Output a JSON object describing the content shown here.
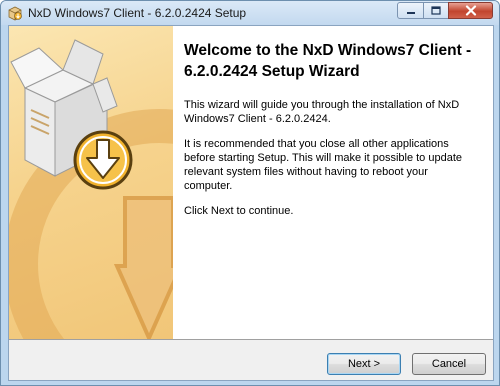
{
  "window": {
    "title": "NxD Windows7 Client - 6.2.0.2424 Setup",
    "icon": "installer-box-icon",
    "controls": [
      "minimize-icon",
      "maximize-icon",
      "close-icon"
    ]
  },
  "wizard": {
    "heading": "Welcome to the NxD Windows7 Client - 6.2.0.2424 Setup Wizard",
    "paragraphs": [
      "This wizard will guide you through the installation of NxD Windows7 Client - 6.2.0.2424.",
      "It is recommended that you close all other applications before starting Setup. This will make it possible to update relevant system files without having to reboot your computer.",
      "Click Next to continue."
    ],
    "side_image": "open-box-download-icon"
  },
  "buttons": {
    "next": "Next >",
    "cancel": "Cancel"
  },
  "colors": {
    "side_panel": "#f6d38d",
    "title_bar": "#c3d9ef",
    "footer": "#f0f0f0"
  }
}
